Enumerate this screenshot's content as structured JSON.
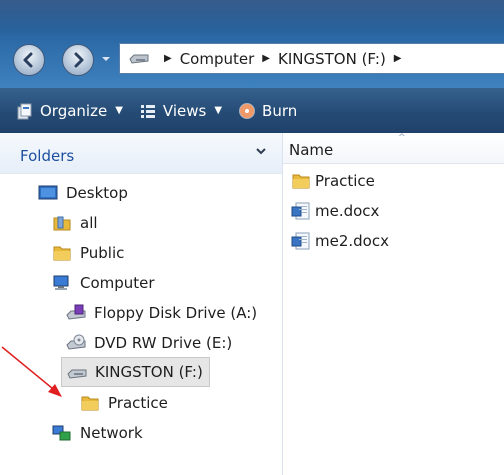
{
  "address": {
    "crumbs": [
      "Computer",
      "KINGSTON (F:)"
    ]
  },
  "toolbar": {
    "organize_label": "Organize",
    "views_label": "Views",
    "burn_label": "Burn"
  },
  "folders_pane": {
    "header_label": "Folders",
    "items": [
      {
        "label": "Desktop",
        "icon": "desktop-icon"
      },
      {
        "label": "all",
        "icon": "user-folder-icon"
      },
      {
        "label": "Public",
        "icon": "folder-icon"
      },
      {
        "label": "Computer",
        "icon": "computer-icon"
      },
      {
        "label": "Floppy Disk Drive (A:)",
        "icon": "floppy-drive-icon"
      },
      {
        "label": "DVD RW Drive (E:)",
        "icon": "dvd-drive-icon"
      },
      {
        "label": "KINGSTON (F:)",
        "icon": "usb-drive-icon",
        "selected": true
      },
      {
        "label": "Practice",
        "icon": "folder-icon"
      },
      {
        "label": "Network",
        "icon": "network-icon"
      }
    ]
  },
  "file_pane": {
    "column_name": "Name",
    "files": [
      {
        "label": "Practice",
        "icon": "folder-icon"
      },
      {
        "label": "me.docx",
        "icon": "word-document-icon"
      },
      {
        "label": "me2.docx",
        "icon": "word-document-icon"
      }
    ]
  },
  "colors": {
    "title_gradient_top": "#1f4a7e",
    "toolbar_bg": "#254b75",
    "folder_yellow": "#e8b93a",
    "annotation_arrow": "#e02020",
    "folders_label": "#1d4fa0"
  }
}
